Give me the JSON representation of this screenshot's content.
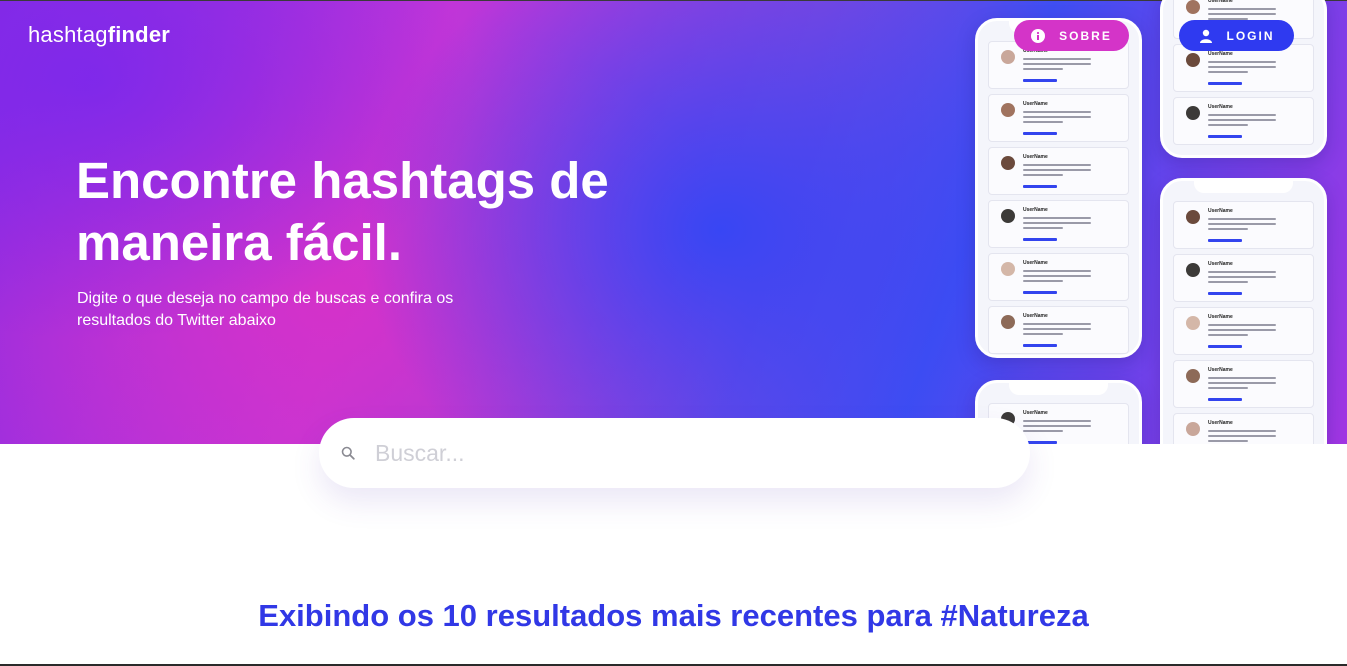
{
  "brand": {
    "logo_prefix": "hashtag",
    "logo_suffix": "finder"
  },
  "nav": {
    "sobre_label": "SOBRE",
    "login_label": "LOGIN"
  },
  "hero": {
    "title": "Encontre hashtags de maneira fácil.",
    "subtitle": "Digite o que deseja no campo de buscas e confira os resultados do Twitter abaixo"
  },
  "search": {
    "placeholder": "Buscar...",
    "value": ""
  },
  "results": {
    "heading": "Exibindo os 10 resultados mais recentes para #Natureza"
  },
  "mockup_tweet": {
    "username": "UserName"
  },
  "icons": {
    "sobre": "info-icon",
    "login": "user-icon",
    "search": "search-icon"
  },
  "colors": {
    "accent_blue": "#3138e6",
    "sobre_pink": "#d434c8",
    "login_blue": "#2f3af0"
  }
}
